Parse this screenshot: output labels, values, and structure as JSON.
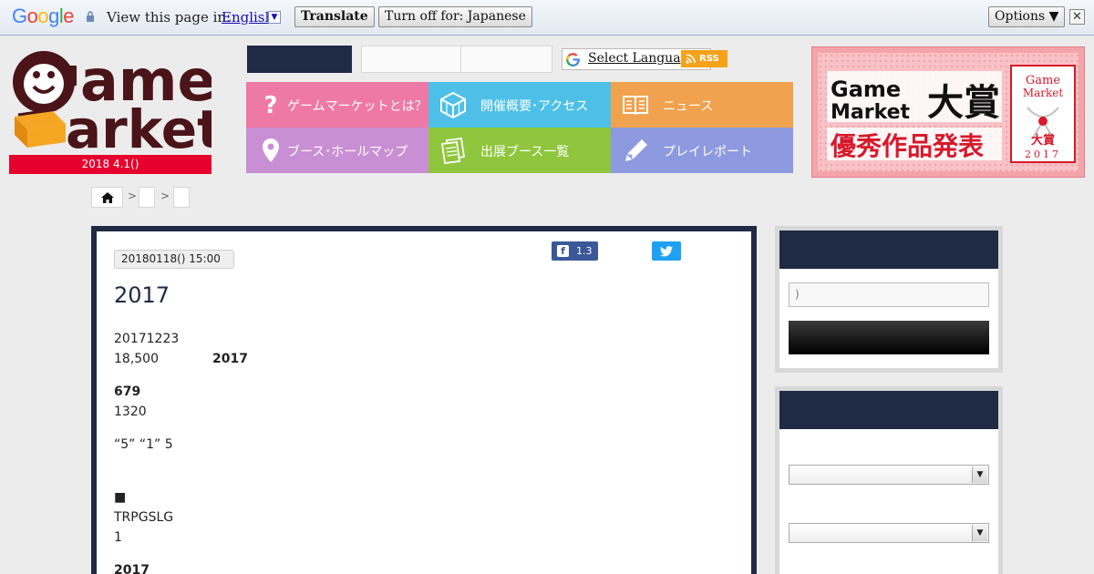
{
  "translate_bar": {
    "logo": "Google",
    "view_label": "View this page in:",
    "language": "English",
    "translate_btn": "Translate",
    "turn_off_btn": "Turn off for: Japanese",
    "options_btn": "Options ▼",
    "close": "✕"
  },
  "header": {
    "date_strip": "2018 4.1()",
    "select_language": "Select Language",
    "rss": "RSS"
  },
  "nav": [
    {
      "label": "ゲームマーケットとは？",
      "color": "#ee79a5",
      "icon": "question-icon"
    },
    {
      "label": "開催概要･アクセス",
      "color": "#4ec0e8",
      "icon": "cube-icon"
    },
    {
      "label": "ニュース",
      "color": "#f0a24f",
      "icon": "book-icon"
    },
    {
      "label": "ブース･ホールマップ",
      "color": "#c98fd4",
      "icon": "map-pin-icon"
    },
    {
      "label": "出展ブース一覧",
      "color": "#8fc63e",
      "icon": "documents-icon"
    },
    {
      "label": "プレイレポート",
      "color": "#8d9ae0",
      "icon": "pen-icon"
    }
  ],
  "breadcrumb": {
    "sep": ">"
  },
  "article": {
    "date": "20180118() 15:00",
    "fb_count": "1.3",
    "title": "2017",
    "lines": [
      {
        "text": "20171223",
        "bold": false
      },
      {
        "text": "18,500",
        "bold": false,
        "extra": "2017"
      },
      {
        "text": "679",
        "bold": true
      },
      {
        "text": "1320",
        "bold": false
      },
      {
        "text": " “5” “1” 5",
        "bold": false
      },
      {
        "text": "■",
        "bold": false
      },
      {
        "text": "TRPGSLG",
        "bold": false
      },
      {
        "text": "1",
        "bold": false
      },
      {
        "text": "2017",
        "bold": true
      }
    ]
  },
  "sidebar": {
    "search_placeholder": ")"
  },
  "colors": {
    "navy": "#1f2a44",
    "red": "#e6002d"
  }
}
